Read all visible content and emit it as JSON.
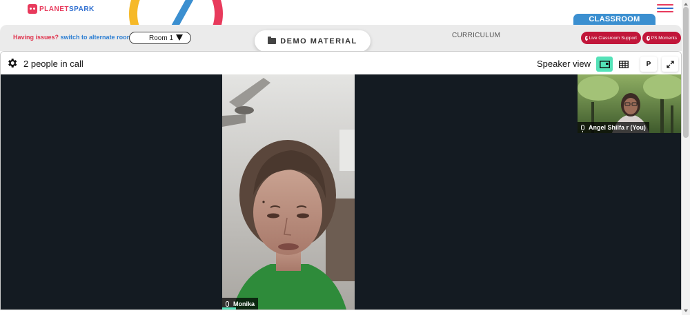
{
  "header": {
    "logo_text_part1": "PLANET",
    "logo_text_part2": "SPARK",
    "classroom_tab": "CLASSROOM",
    "menu_icon": "hamburger-icon"
  },
  "subbar": {
    "issue_text": "Having issues?",
    "switch_text": "switch to alternate room",
    "room_selected": "Room 1",
    "demo_material": "DEMO MATERIAL",
    "curriculum": "CURRICULUM",
    "live_support": "Live Classroom Support",
    "ps_moments": "PS Moments"
  },
  "call": {
    "people_count": "2 people in call",
    "view_label": "Speaker view",
    "p_button": "P"
  },
  "participants": [
    {
      "name": "Monika"
    },
    {
      "name": "Angel Shilfa r (You)"
    }
  ],
  "colors": {
    "brand_red": "#e83a5c",
    "brand_blue": "#2f6fd0",
    "classroom_blue": "#3b8fd0",
    "pill_red": "#c1163a",
    "active_green": "#54e2b8",
    "stage_bg": "#141b22"
  }
}
